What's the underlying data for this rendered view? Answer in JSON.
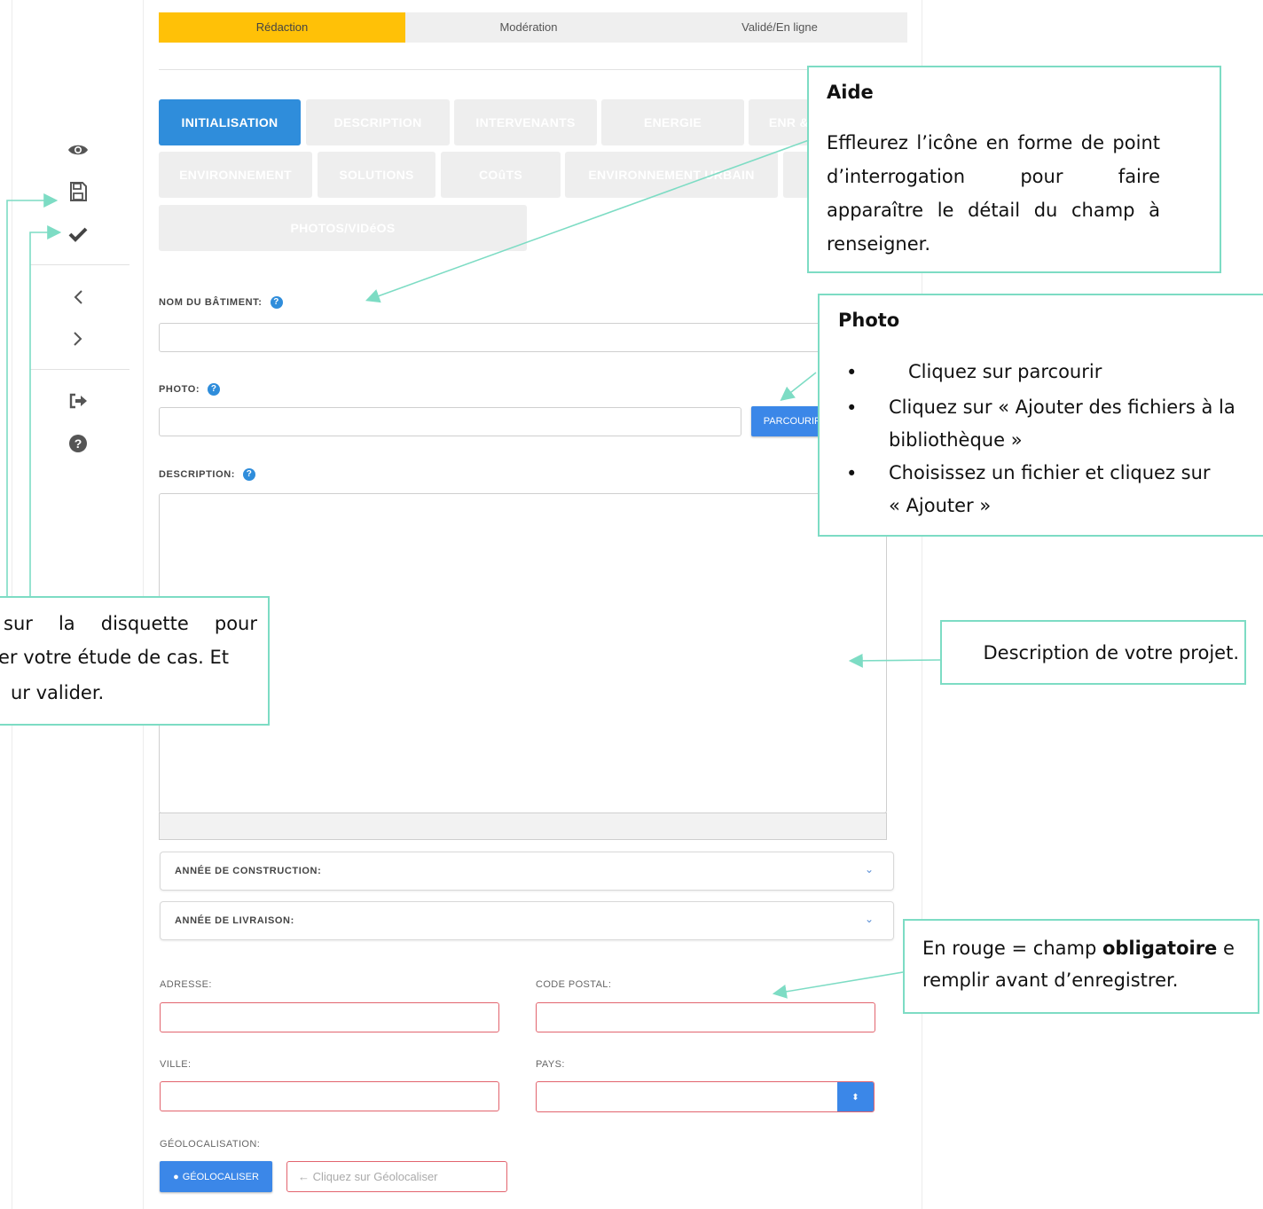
{
  "steps": [
    "Rédaction",
    "Modération",
    "Validé/En ligne"
  ],
  "sidebar": {
    "icons": [
      "eye-icon",
      "save-icon",
      "check-icon",
      "chevron-left-icon",
      "chevron-right-icon",
      "sign-out-icon",
      "question-circle-icon"
    ]
  },
  "tabs": {
    "row1": [
      "INITIALISATION",
      "DESCRIPTION",
      "INTERVENANTS",
      "ENERGIE",
      "ENR & SYSTèMES"
    ],
    "row2": [
      "ENVIRONNEMENT",
      "SOLUTIONS",
      "COûTS",
      "ENVIRONNEMENT URBAIN"
    ],
    "row3": [
      "PHOTOS/VIDéOS"
    ]
  },
  "form": {
    "nom_label": "NOM DU BÂTIMENT:",
    "photo_label": "PHOTO:",
    "browse_button": "PARCOURIR ...",
    "description_label": "DESCRIPTION:",
    "annee_construction": "ANNÉE DE CONSTRUCTION:",
    "annee_livraison": "ANNÉE DE LIVRAISON:",
    "adresse_label": "ADRESSE:",
    "code_postal_label": "CODE POSTAL:",
    "ville_label": "VILLE:",
    "pays_label": "PAYS:",
    "geoloc_label": "GÉOLOCALISATION:",
    "geoloc_button": "GÉOLOCALISER",
    "geoloc_placeholder": "← Cliquez sur Géolocaliser"
  },
  "callouts": {
    "aide_title": "Aide",
    "aide_body": "Effleurez l’icône en forme de point d’interrogation pour faire apparaître le détail du champ à renseigner.",
    "photo_title": "Photo",
    "photo_items": [
      "Cliquez sur parcourir",
      "Cliquez sur « Ajouter des fichiers à la bibliothèque »",
      "Choisissez un fichier et cliquez sur « Ajouter »"
    ],
    "disquette_lines": [
      "sur la disquette pour",
      "er votre étude de cas. Et",
      "ur valider."
    ],
    "description_note": "Description de votre projet.",
    "rouge_prefix": "En rouge = champ ",
    "rouge_bold": "obligatoire",
    "rouge_suffix": " e",
    "rouge_line2": "remplir avant d’enregistrer."
  },
  "colors": {
    "accent_yellow": "#ffc107",
    "tab_blue": "#2f8ddb",
    "button_blue": "#3b87e8",
    "required_red": "#e2646e",
    "callout_teal": "#7ddcc4"
  }
}
